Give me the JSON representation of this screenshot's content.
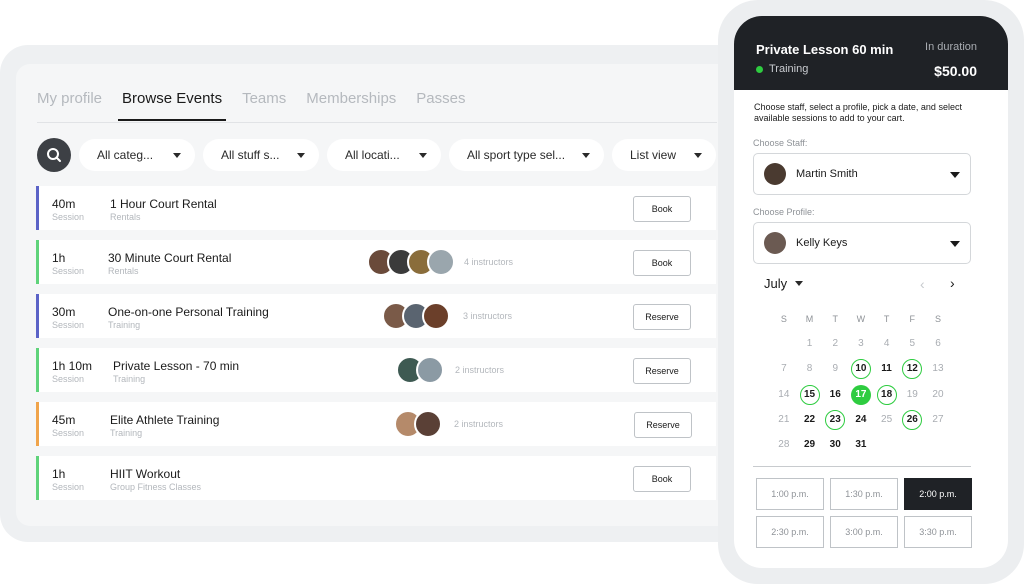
{
  "tabs": [
    "My profile",
    "Browse Events",
    "Teams",
    "Memberships",
    "Passes"
  ],
  "filters": {
    "category": "All categ...",
    "staff": "All stuff s...",
    "location": "All locati...",
    "sport_type": "All sport type sel...",
    "view": "List view"
  },
  "events": [
    {
      "duration": "40m",
      "kind": "Session",
      "title": "1 Hour Court Rental",
      "subtitle": "Rentals",
      "instructors": "",
      "button": "Book",
      "accent": "#5b63c7"
    },
    {
      "duration": "1h",
      "kind": "Session",
      "title": "30 Minute Court Rental",
      "subtitle": "Rentals",
      "instructors": "4 instructors",
      "button": "Book",
      "accent": "#5fd37a"
    },
    {
      "duration": "30m",
      "kind": "Session",
      "title": "One-on-one Personal Training",
      "subtitle": "Training",
      "instructors": "3 instructors",
      "button": "Reserve",
      "accent": "#5b63c7"
    },
    {
      "duration": "1h 10m",
      "kind": "Session",
      "title": "Private Lesson - 70 min",
      "subtitle": "Training",
      "instructors": "2 instructors",
      "button": "Reserve",
      "accent": "#5fd37a"
    },
    {
      "duration": "45m",
      "kind": "Session",
      "title": "Elite Athlete Training",
      "subtitle": "Training",
      "instructors": "2 instructors",
      "button": "Reserve",
      "accent": "#f0a44b"
    },
    {
      "duration": "1h",
      "kind": "Session",
      "title": "HIIT Workout",
      "subtitle": "Group Fitness Classes",
      "instructors": "",
      "button": "Book",
      "accent": "#5fd37a"
    }
  ],
  "booking": {
    "title": "Private Lesson 60 min",
    "category": "Training",
    "duration_label": "In duration",
    "price": "$50.00",
    "instructions": "Choose staff, select a profile, pick a date, and select available sessions to add to your cart.",
    "staff_label": "Choose Staff:",
    "staff_value": "Martin Smith",
    "profile_label": "Choose Profile:",
    "profile_value": "Kelly Keys",
    "month": "July",
    "weekdays": [
      "S",
      "M",
      "T",
      "W",
      "T",
      "F",
      "S"
    ],
    "weeks": [
      [
        "",
        "1",
        "2",
        "3",
        "4",
        "5",
        "6"
      ],
      [
        "7",
        "8",
        "9",
        "10",
        "11",
        "12",
        "13"
      ],
      [
        "14",
        "15",
        "16",
        "17",
        "18",
        "19",
        "20"
      ],
      [
        "21",
        "22",
        "23",
        "24",
        "25",
        "26",
        "27"
      ],
      [
        "28",
        "29",
        "30",
        "31",
        "",
        "",
        ""
      ]
    ],
    "available_dates": [
      "10",
      "12",
      "15",
      "18",
      "23",
      "26"
    ],
    "selected_date": "17",
    "bold_dates": [
      "11",
      "16",
      "22",
      "24",
      "29",
      "30",
      "31"
    ],
    "time_slots": [
      "1:00 p.m.",
      "1:30 p.m.",
      "2:00 p.m.",
      "2:30 p.m.",
      "3:00 p.m.",
      "3:30 p.m."
    ],
    "selected_slot": "2:00 p.m."
  },
  "colors": {
    "accent_green": "#2ecc40",
    "dark": "#1f2226"
  }
}
